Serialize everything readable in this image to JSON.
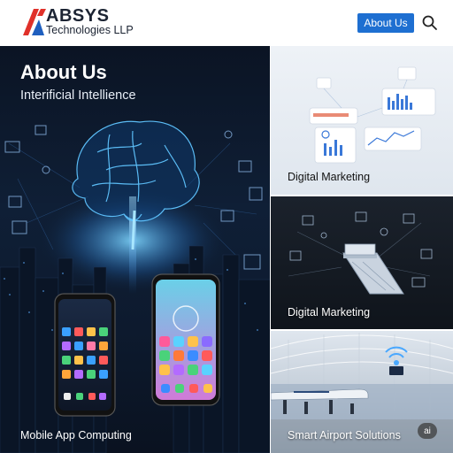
{
  "header": {
    "brand_name": "ABSYS",
    "brand_sub": "Technologies LLP",
    "about_button": "About Us"
  },
  "hero": {
    "title": "About Us",
    "subtitle": "Interificial Intellience",
    "caption": "Mobile App Computing"
  },
  "tiles": [
    {
      "caption": "Digital Marketing"
    },
    {
      "caption": "Digital Marketing"
    },
    {
      "caption": "Smart Airport Solutions"
    }
  ],
  "badge": {
    "label": "ai"
  },
  "colors": {
    "accent": "#1e6fd1",
    "logo_red": "#e0312a",
    "logo_blue": "#1f5fbf"
  }
}
